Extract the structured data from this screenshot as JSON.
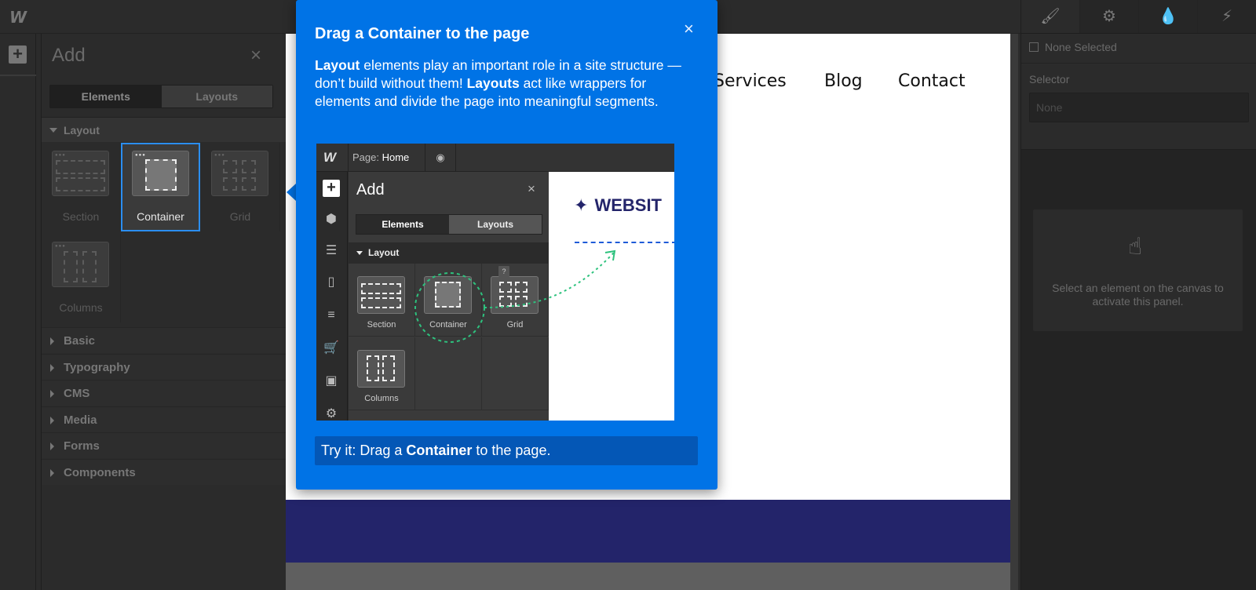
{
  "app": {
    "logo": "W"
  },
  "rail": {
    "add_icon": "plus-icon"
  },
  "add_panel": {
    "title": "Add",
    "close": "×",
    "tabs": [
      {
        "label": "Elements",
        "active": true
      },
      {
        "label": "Layouts",
        "active": false
      }
    ],
    "open_category": "Layout",
    "layout_items": [
      {
        "label": "Section",
        "selected": false
      },
      {
        "label": "Container",
        "selected": true
      },
      {
        "label": "Grid",
        "selected": false
      },
      {
        "label": "Columns",
        "selected": false
      }
    ],
    "categories": [
      "Basic",
      "Typography",
      "CMS",
      "Media",
      "Forms",
      "Components"
    ]
  },
  "canvas": {
    "nav": [
      "Services",
      "Blog",
      "Contact"
    ],
    "footer_color": "#23246a"
  },
  "right_panel": {
    "tabs": [
      {
        "icon": "brush-icon",
        "glyph": "🖌"
      },
      {
        "icon": "gear-icon",
        "glyph": "⚙"
      },
      {
        "icon": "drops-icon",
        "glyph": "💧"
      },
      {
        "icon": "lightning-icon",
        "glyph": "⚡"
      }
    ],
    "none_selected": "None Selected",
    "selector_label": "Selector",
    "selector_placeholder": "None",
    "hint": "Select an element on the canvas to activate this panel."
  },
  "tour": {
    "title": "Drag a Container to the page",
    "close": "×",
    "body": {
      "b1": "Layout",
      "t1": " elements play an important role in a site structure — don’t build without them! ",
      "b2": "Layouts",
      "t2": " act like wrappers for elements and divide the page into meaningful segments."
    },
    "cta": {
      "pre": "Try it: Drag a ",
      "bold": "Container",
      "post": " to the page."
    },
    "accent": "#0073e6",
    "mini": {
      "logo": "W",
      "page_label": "Page:",
      "page_name": "Home",
      "add_title": "Add",
      "close": "×",
      "tabs": [
        "Elements",
        "Layouts"
      ],
      "category": "Layout",
      "items": [
        "Section",
        "Container",
        "Grid",
        "Columns"
      ],
      "help": "?",
      "brand": "WEBSIT",
      "brand_icon": "✦"
    }
  }
}
